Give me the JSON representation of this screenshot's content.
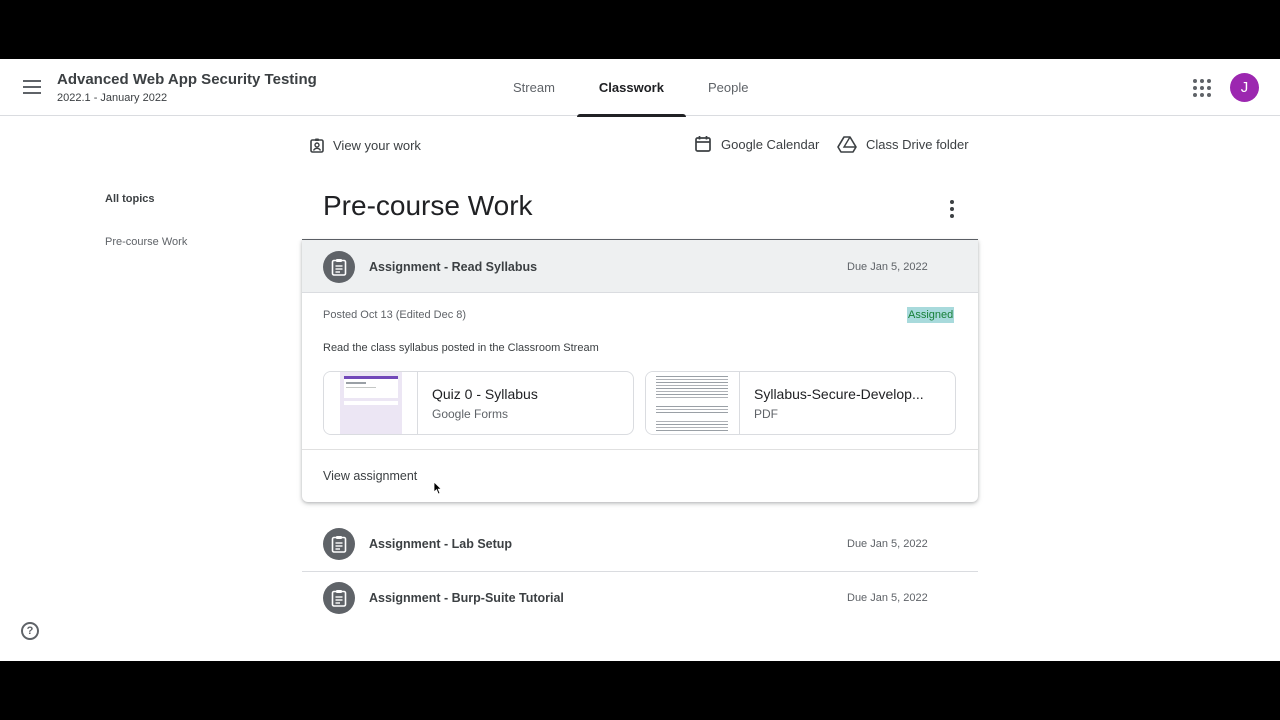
{
  "header": {
    "class_title": "Advanced Web App Security Testing",
    "class_subtitle": "2022.1 - January 2022",
    "tabs": [
      {
        "label": "Stream"
      },
      {
        "label": "Classwork"
      },
      {
        "label": "People"
      }
    ],
    "active_tab": "Classwork",
    "avatar_letter": "J",
    "avatar_color": "#9c27b0"
  },
  "toolbar": {
    "view_work": "View your work",
    "calendar": "Google Calendar",
    "drive": "Class Drive folder"
  },
  "sidebar": {
    "items": [
      {
        "label": "All topics"
      },
      {
        "label": "Pre-course Work"
      }
    ]
  },
  "topic": {
    "title": "Pre-course Work",
    "expanded": {
      "title": "Assignment - Read Syllabus",
      "due": "Due Jan 5, 2022",
      "posted": "Posted Oct 13 (Edited Dec 8)",
      "status": "Assigned",
      "description": "Read the class syllabus posted in the Classroom Stream",
      "attachments": [
        {
          "title": "Quiz 0 - Syllabus",
          "type": "Google Forms"
        },
        {
          "title": "Syllabus-Secure-Develop...",
          "type": "PDF"
        }
      ],
      "view_link": "View assignment"
    },
    "assignments": [
      {
        "title": "Assignment - Lab Setup",
        "due": "Due Jan 5, 2022"
      },
      {
        "title": "Assignment - Burp-Suite Tutorial",
        "due": "Due Jan 5, 2022"
      }
    ]
  },
  "help_icon": "?"
}
